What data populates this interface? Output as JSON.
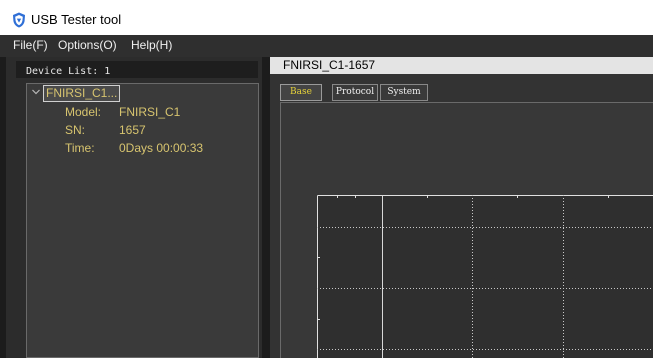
{
  "window": {
    "title": "USB Tester tool",
    "icon": "shield-icon"
  },
  "menu": {
    "items": [
      {
        "label": "File(F)"
      },
      {
        "label": "Options(O)"
      },
      {
        "label": "Help(H)"
      }
    ]
  },
  "device_list": {
    "header": "Device List: 1",
    "device": {
      "name": "FNIRSI_C1...",
      "expanded": true,
      "details": [
        {
          "key": "Model:",
          "value": "FNIRSI_C1"
        },
        {
          "key": "SN:",
          "value": "1657"
        },
        {
          "key": "Time:",
          "value": "0Days 00:00:33"
        }
      ]
    }
  },
  "device_panel": {
    "title": "FNIRSI_C1-1657",
    "tabs": [
      {
        "label": "Base",
        "active": true
      },
      {
        "label": "Protocol",
        "active": false
      },
      {
        "label": "System",
        "active": false
      }
    ]
  },
  "colors": {
    "menubar": "#2f2f2f",
    "panel": "#2c2c2c",
    "text_accent": "#d7c46f",
    "active_tab": "#e6d23a",
    "plot_bg": "#2f2f2f",
    "grid": "#c8c8c8",
    "plot_border": "#e0e0e0"
  }
}
